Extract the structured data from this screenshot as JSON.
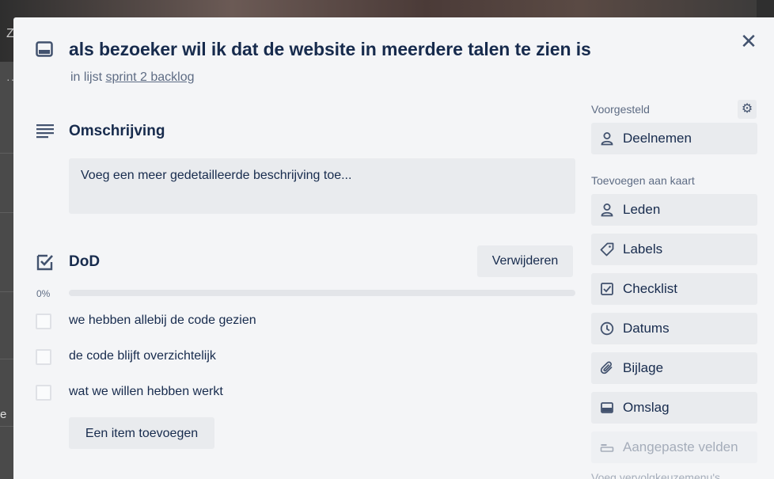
{
  "background": {
    "left_char": "Z",
    "left_bottom_char": "e"
  },
  "card": {
    "title": "als bezoeker wil ik dat de website in meerdere talen te zien is",
    "in_list_prefix": "in lijst",
    "list_name": "sprint 2 backlog"
  },
  "description": {
    "heading": "Omschrijving",
    "placeholder": "Voeg een meer gedetailleerde beschrijving toe..."
  },
  "checklist": {
    "heading": "DoD",
    "delete_label": "Verwijderen",
    "progress_percent": 0,
    "progress_label": "0%",
    "items": [
      {
        "text": "we hebben allebij de code gezien",
        "checked": false
      },
      {
        "text": "de code blijft overzichtelijk",
        "checked": false
      },
      {
        "text": "wat we willen hebben werkt",
        "checked": false
      }
    ],
    "add_item_label": "Een item toevoegen"
  },
  "sidebar": {
    "suggested_label": "Voorgesteld",
    "join_label": "Deelnemen",
    "add_to_card_label": "Toevoegen aan kaart",
    "buttons": [
      {
        "label": "Leden",
        "icon": "person-icon"
      },
      {
        "label": "Labels",
        "icon": "tag-icon"
      },
      {
        "label": "Checklist",
        "icon": "checklist-icon"
      },
      {
        "label": "Datums",
        "icon": "clock-icon"
      },
      {
        "label": "Bijlage",
        "icon": "paperclip-icon"
      },
      {
        "label": "Omslag",
        "icon": "cover-icon"
      },
      {
        "label": "Aangepaste velden",
        "icon": "custom-fields-icon"
      }
    ],
    "cut_off_text": "Voeg vervolgkeuzemenu's"
  },
  "colors": {
    "modal_bg": "#f4f5f7",
    "button_bg": "#e9ebee",
    "text_primary": "#172b4d",
    "text_secondary": "#5e6c84"
  }
}
